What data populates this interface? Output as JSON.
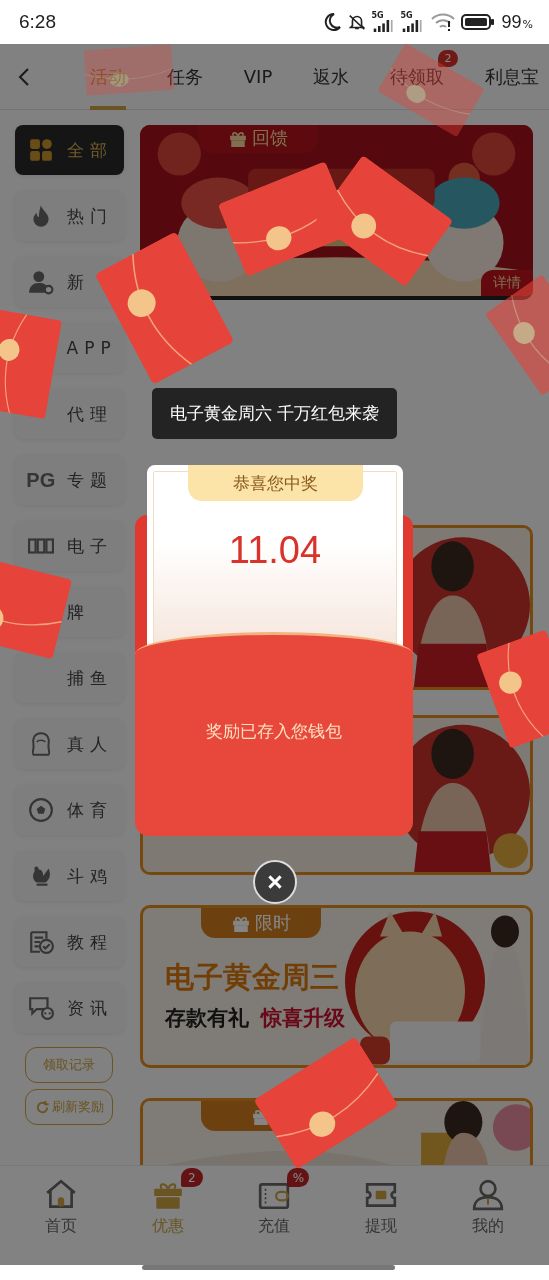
{
  "status_bar": {
    "time": "6:28",
    "network_labels": [
      "5G",
      "5G"
    ],
    "battery": "99",
    "battery_unit": "%"
  },
  "header": {
    "tabs": [
      {
        "label": "活动",
        "selected": true
      },
      {
        "label": "任务",
        "selected": false
      },
      {
        "label": "VIP",
        "selected": false
      },
      {
        "label": "返水",
        "selected": false
      },
      {
        "label": "待领取",
        "selected": false,
        "badge": "2"
      },
      {
        "label": "利息宝",
        "selected": false
      }
    ]
  },
  "sidebar": {
    "items": [
      {
        "label": "全部",
        "selected": true
      },
      {
        "label": "热门",
        "selected": false
      },
      {
        "label": "新",
        "selected": false
      },
      {
        "label": "APP",
        "selected": false
      },
      {
        "label": "代理",
        "selected": false
      },
      {
        "label": "专题",
        "icon_text": "PG",
        "selected": false
      },
      {
        "label": "电子",
        "selected": false
      },
      {
        "label": "牌",
        "selected": false
      },
      {
        "label": "捕鱼",
        "selected": false
      },
      {
        "label": "真人",
        "selected": false
      },
      {
        "label": "体育",
        "selected": false
      },
      {
        "label": "斗鸡",
        "selected": false
      },
      {
        "label": "教程",
        "selected": false
      },
      {
        "label": "资讯",
        "selected": false
      }
    ],
    "buttons": [
      "领取记录",
      "刷新奖励"
    ]
  },
  "banners": [
    {
      "kind": "festival",
      "tag": "回馈",
      "button": "详情"
    },
    {
      "kind": "figure"
    },
    {
      "kind": "figure"
    },
    {
      "kind": "promo",
      "tag": "限时",
      "headline": "电子黄金周三",
      "subline": "存款有礼",
      "highlight": "惊喜升级"
    },
    {
      "kind": "promo_cut"
    }
  ],
  "toast": "电子黄金周六 千万红包来袭",
  "prize_modal": {
    "title": "恭喜您中奖",
    "amount": "11.04",
    "message": "奖励已存入您钱包"
  },
  "bottom_nav": [
    {
      "label": "首页",
      "selected": false
    },
    {
      "label": "优惠",
      "selected": true,
      "badge": "2"
    },
    {
      "label": "充值",
      "selected": false,
      "badge": "%"
    },
    {
      "label": "提现",
      "selected": false
    },
    {
      "label": "我的",
      "selected": false
    }
  ]
}
